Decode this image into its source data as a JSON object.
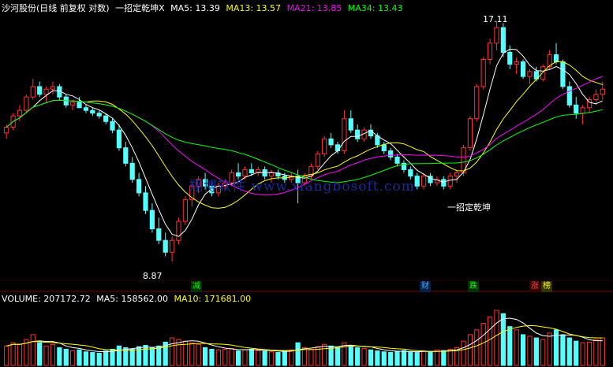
{
  "header": {
    "title": "沙河股份(日线 前复权 对数)",
    "indicator": "一招定乾坤X",
    "ma5": "MA5: 13.39",
    "ma13": "MA13: 13.57",
    "ma21": "MA21: 13.85",
    "ma34": "MA34: 13.43",
    "colors": {
      "title": "#ffffff",
      "ma5": "#ffffff",
      "ma13": "#ffff00",
      "ma21": "#ff00ff",
      "ma34": "#00ff00"
    }
  },
  "price_panel": {
    "high_label": "17.11",
    "low_label": "8.87",
    "signal_label": "一招定乾坤",
    "watermark": "翔博软件 www.xiangbosoft.com"
  },
  "events": [
    {
      "text": "减",
      "color": "#00ff00"
    },
    {
      "text": "财",
      "color": "#00a0ff"
    },
    {
      "text": "跌",
      "color": "#00ff00"
    },
    {
      "text": "涨",
      "color": "#ff4040"
    },
    {
      "text": "榜",
      "color": "#ffff00"
    }
  ],
  "volume_header": {
    "volume": "VOLUME: 207172.72",
    "ma5": "MA5: 158562.00",
    "ma10": "MA10: 171681.00"
  },
  "chart_data": {
    "type": "candlestick",
    "ylim": [
      8.5,
      17.5
    ],
    "candles": [
      [
        12.6,
        12.9,
        12.4,
        12.8
      ],
      [
        12.8,
        13.3,
        12.7,
        13.2
      ],
      [
        13.2,
        13.6,
        13.0,
        13.4
      ],
      [
        13.4,
        14.0,
        13.3,
        13.9
      ],
      [
        13.9,
        14.6,
        13.8,
        14.3
      ],
      [
        14.3,
        14.5,
        13.9,
        14.0
      ],
      [
        14.0,
        14.3,
        13.7,
        14.2
      ],
      [
        14.2,
        14.5,
        14.0,
        14.3
      ],
      [
        14.3,
        14.4,
        13.8,
        13.9
      ],
      [
        13.9,
        14.0,
        13.5,
        13.6
      ],
      [
        13.6,
        13.8,
        13.4,
        13.7
      ],
      [
        13.7,
        13.9,
        13.5,
        13.5
      ],
      [
        13.5,
        13.6,
        13.3,
        13.4
      ],
      [
        13.4,
        13.5,
        13.2,
        13.3
      ],
      [
        13.3,
        13.4,
        13.1,
        13.2
      ],
      [
        13.2,
        13.3,
        12.9,
        13.0
      ],
      [
        13.0,
        13.1,
        12.6,
        12.7
      ],
      [
        12.7,
        12.9,
        12.0,
        12.1
      ],
      [
        12.1,
        12.3,
        11.5,
        11.6
      ],
      [
        11.6,
        11.8,
        11.0,
        11.1
      ],
      [
        11.1,
        11.3,
        10.6,
        10.7
      ],
      [
        10.7,
        10.9,
        10.1,
        10.2
      ],
      [
        10.2,
        10.4,
        9.6,
        9.7
      ],
      [
        9.7,
        10.0,
        9.3,
        9.4
      ],
      [
        9.4,
        9.6,
        9.0,
        9.1
      ],
      [
        9.1,
        9.5,
        8.87,
        9.4
      ],
      [
        9.4,
        10.0,
        9.3,
        9.9
      ],
      [
        9.9,
        10.6,
        9.8,
        10.5
      ],
      [
        10.5,
        11.0,
        10.3,
        10.9
      ],
      [
        10.9,
        11.2,
        10.7,
        11.1
      ],
      [
        11.1,
        11.3,
        10.8,
        10.9
      ],
      [
        10.9,
        11.0,
        10.6,
        10.7
      ],
      [
        10.7,
        11.0,
        10.6,
        10.9
      ],
      [
        10.9,
        11.1,
        10.8,
        11.0
      ],
      [
        11.0,
        11.4,
        10.9,
        11.3
      ],
      [
        11.3,
        11.6,
        11.1,
        11.2
      ],
      [
        11.2,
        11.5,
        11.1,
        11.4
      ],
      [
        11.4,
        11.6,
        11.2,
        11.3
      ],
      [
        11.3,
        11.5,
        11.2,
        11.4
      ],
      [
        11.4,
        11.5,
        11.1,
        11.2
      ],
      [
        11.2,
        11.4,
        11.0,
        11.3
      ],
      [
        11.3,
        11.4,
        11.1,
        11.2
      ],
      [
        11.2,
        11.3,
        11.0,
        11.1
      ],
      [
        11.1,
        11.3,
        11.0,
        11.2
      ],
      [
        11.2,
        11.4,
        10.4,
        11.0
      ],
      [
        11.0,
        11.3,
        10.9,
        11.2
      ],
      [
        11.2,
        11.6,
        11.1,
        11.5
      ],
      [
        11.5,
        12.0,
        11.4,
        11.9
      ],
      [
        11.9,
        12.5,
        11.8,
        12.4
      ],
      [
        12.4,
        12.6,
        12.1,
        12.2
      ],
      [
        12.2,
        12.3,
        11.9,
        12.0
      ],
      [
        12.0,
        13.4,
        11.9,
        13.1
      ],
      [
        13.1,
        13.4,
        12.6,
        12.7
      ],
      [
        12.7,
        12.9,
        12.3,
        12.4
      ],
      [
        12.4,
        12.8,
        12.3,
        12.7
      ],
      [
        12.7,
        12.9,
        12.4,
        12.5
      ],
      [
        12.5,
        12.6,
        12.1,
        12.2
      ],
      [
        12.2,
        12.3,
        11.9,
        12.0
      ],
      [
        12.0,
        12.1,
        11.7,
        11.8
      ],
      [
        11.8,
        11.9,
        11.5,
        11.6
      ],
      [
        11.6,
        11.7,
        11.3,
        11.4
      ],
      [
        11.4,
        11.5,
        11.1,
        11.2
      ],
      [
        11.2,
        11.3,
        10.8,
        10.9
      ],
      [
        10.9,
        11.3,
        10.8,
        11.2
      ],
      [
        11.2,
        11.3,
        10.9,
        11.0
      ],
      [
        11.0,
        11.2,
        10.9,
        11.1
      ],
      [
        11.1,
        11.2,
        10.8,
        10.9
      ],
      [
        10.9,
        11.3,
        10.8,
        11.2
      ],
      [
        11.2,
        11.4,
        11.0,
        11.3
      ],
      [
        11.3,
        12.2,
        11.2,
        12.1
      ],
      [
        12.1,
        13.2,
        12.0,
        13.1
      ],
      [
        13.1,
        14.4,
        13.0,
        14.3
      ],
      [
        14.3,
        15.5,
        14.2,
        15.4
      ],
      [
        15.4,
        16.3,
        15.2,
        16.1
      ],
      [
        16.1,
        17.11,
        15.8,
        16.8
      ],
      [
        16.8,
        17.0,
        15.5,
        15.7
      ],
      [
        15.7,
        16.0,
        15.0,
        15.2
      ],
      [
        15.2,
        15.5,
        14.8,
        15.3
      ],
      [
        15.3,
        15.4,
        14.6,
        14.7
      ],
      [
        14.7,
        15.0,
        14.4,
        14.9
      ],
      [
        14.9,
        15.1,
        14.5,
        14.6
      ],
      [
        14.6,
        15.2,
        14.5,
        15.1
      ],
      [
        15.1,
        15.8,
        15.0,
        15.6
      ],
      [
        15.6,
        16.1,
        15.2,
        15.3
      ],
      [
        15.3,
        15.4,
        14.2,
        14.3
      ],
      [
        14.3,
        14.5,
        13.5,
        13.6
      ],
      [
        13.6,
        13.9,
        13.1,
        13.3
      ],
      [
        13.3,
        13.6,
        12.9,
        13.5
      ],
      [
        13.5,
        13.9,
        13.3,
        13.8
      ],
      [
        13.8,
        14.2,
        13.6,
        14.0
      ],
      [
        14.0,
        14.5,
        13.8,
        14.2
      ]
    ],
    "volume": [
      60,
      70,
      65,
      80,
      95,
      70,
      60,
      65,
      55,
      50,
      45,
      48,
      42,
      40,
      38,
      45,
      50,
      60,
      55,
      50,
      58,
      62,
      55,
      60,
      72,
      85,
      80,
      75,
      70,
      65,
      55,
      50,
      48,
      50,
      52,
      45,
      48,
      50,
      46,
      44,
      42,
      40,
      45,
      48,
      70,
      55,
      50,
      58,
      65,
      60,
      55,
      70,
      62,
      55,
      52,
      48,
      45,
      42,
      40,
      44,
      46,
      42,
      40,
      45,
      42,
      48,
      46,
      50,
      55,
      75,
      95,
      110,
      130,
      150,
      170,
      160,
      120,
      110,
      95,
      90,
      85,
      80,
      100,
      110,
      95,
      85,
      75,
      70,
      72,
      80,
      85
    ],
    "vol_ylim": [
      0,
      180
    ]
  }
}
